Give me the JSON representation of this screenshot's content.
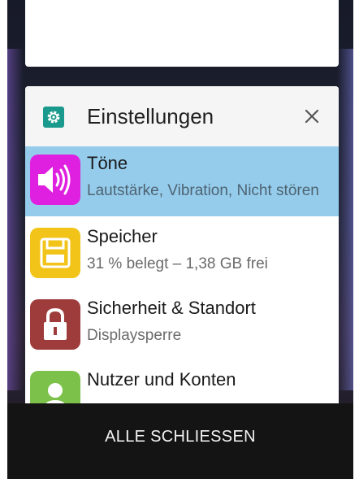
{
  "app_card": {
    "title": "Einstellungen",
    "app_icon": "gear-icon",
    "close_icon": "close-icon"
  },
  "settings_items": [
    {
      "title": "Töne",
      "subtitle": "Lautstärke, Vibration, Nicht stören",
      "icon": "speaker-icon",
      "color": "#e020e0",
      "selected": true
    },
    {
      "title": "Speicher",
      "subtitle": "31 % belegt – 1,38 GB frei",
      "icon": "storage-icon",
      "color": "#f2c419",
      "selected": false
    },
    {
      "title": "Sicherheit & Standort",
      "subtitle": "Displaysperre",
      "icon": "lock-icon",
      "color": "#9e3b3b",
      "selected": false
    },
    {
      "title": "Nutzer und Konten",
      "subtitle": "",
      "icon": "user-icon",
      "color": "#7cc24a",
      "selected": false
    }
  ],
  "bottom": {
    "clear_all_label": "ALLE SCHLIESSEN"
  },
  "colors": {
    "selected_row": "#95ccec",
    "app_icon_bg": "#1a9a8c"
  }
}
